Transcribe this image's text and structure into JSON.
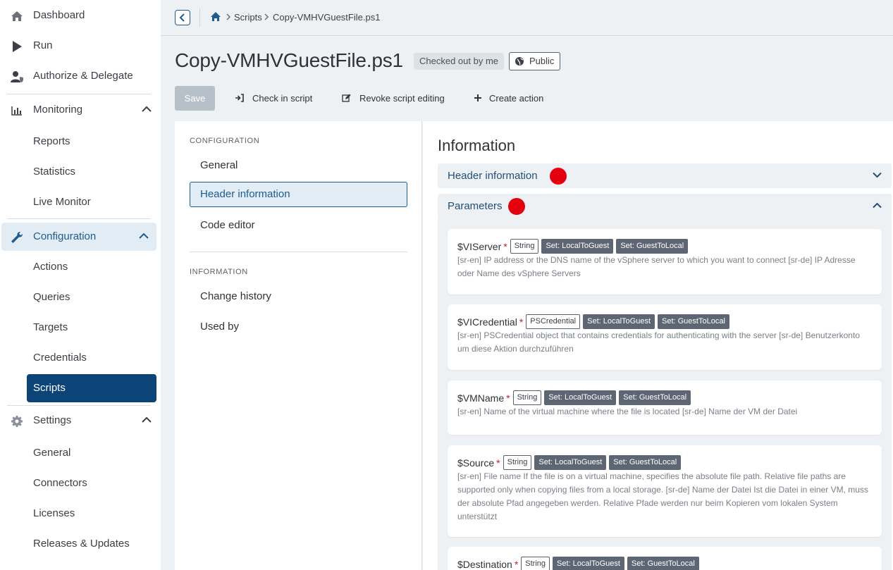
{
  "sidebar": {
    "items": [
      {
        "label": "Dashboard",
        "icon": "home-icon"
      },
      {
        "label": "Run",
        "icon": "play-icon"
      },
      {
        "label": "Authorize & Delegate",
        "icon": "user-shield-icon"
      },
      {
        "label": "Monitoring",
        "icon": "chart-icon"
      },
      {
        "label": "Configuration",
        "icon": "wrench-icon"
      },
      {
        "label": "Settings",
        "icon": "gear-icon"
      }
    ],
    "monitoring_sub": [
      "Reports",
      "Statistics",
      "Live Monitor"
    ],
    "configuration_sub": [
      "Actions",
      "Queries",
      "Targets",
      "Credentials",
      "Scripts"
    ],
    "settings_sub": [
      "General",
      "Connectors",
      "Licenses",
      "Releases & Updates"
    ]
  },
  "breadcrumb": {
    "items": [
      "Scripts",
      "Copy-VMHVGuestFile.ps1"
    ]
  },
  "page": {
    "title": "Copy-VMHVGuestFile.ps1",
    "status_badge": "Checked out by me",
    "visibility_badge": "Public"
  },
  "toolbar": {
    "save_label": "Save",
    "check_in_label": "Check in script",
    "revoke_label": "Revoke script editing",
    "create_action_label": "Create action"
  },
  "config_nav": {
    "configuration_heading": "CONFIGURATION",
    "configuration_items": [
      "General",
      "Header information",
      "Code editor"
    ],
    "information_heading": "INFORMATION",
    "information_items": [
      "Change history",
      "Used by"
    ]
  },
  "info": {
    "title": "Information",
    "header_section": "Header information",
    "parameters_section": "Parameters",
    "parameters": [
      {
        "name": "$VIServer",
        "required": "*",
        "type": "String",
        "sets": [
          "Set: LocalToGuest",
          "Set: GuestToLocal"
        ],
        "description": "[sr-en] IP address or the DNS name of the vSphere server to which you want to connect [sr-de] IP Adresse oder Name des vSphere Servers"
      },
      {
        "name": "$VICredential",
        "required": "*",
        "type": "PSCredential",
        "sets": [
          "Set: LocalToGuest",
          "Set: GuestToLocal"
        ],
        "description": "[sr-en] PSCredential object that contains credentials for authenticating with the server [sr-de] Benutzerkonto um diese Aktion durchzuführen"
      },
      {
        "name": "$VMName",
        "required": "*",
        "type": "String",
        "sets": [
          "Set: LocalToGuest",
          "Set: GuestToLocal"
        ],
        "description": "[sr-en] Name of the virtual machine where the file is located [sr-de] Name der VM der Datei"
      },
      {
        "name": "$Source",
        "required": "*",
        "type": "String",
        "sets": [
          "Set: LocalToGuest",
          "Set: GuestToLocal"
        ],
        "description": "[sr-en] File name If the file is on a virtual machine, specifies the absolute file path. Relative file paths are supported only when copying files from a local storage. [sr-de] Name der Datei Ist die Datei in einer VM, muss der absolute Pfad angegeben werden. Relative Pfade werden nur beim Kopieren vom lokalen System unterstützt"
      },
      {
        "name": "$Destination",
        "required": "*",
        "type": "String",
        "sets": [
          "Set: LocalToGuest",
          "Set: GuestToLocal"
        ],
        "description": ""
      }
    ]
  },
  "colors": {
    "accent": "#1f5b8c",
    "active_nav": "#0c4478",
    "marker": "#e3000f",
    "required": "#c0232c"
  }
}
